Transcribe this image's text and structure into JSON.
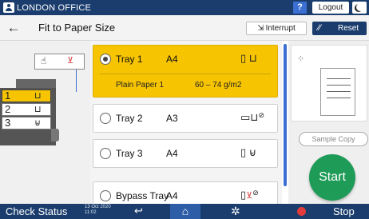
{
  "topbar": {
    "office_name": "LONDON OFFICE",
    "help_label": "?",
    "logout_label": "Logout"
  },
  "titlebar": {
    "back_symbol": "←",
    "title": "Fit to Paper Size",
    "interrupt_label": "Interrupt",
    "reset_label": "Reset"
  },
  "machine_diagram": {
    "trays": [
      {
        "number": "1",
        "selected": true
      },
      {
        "number": "2",
        "selected": false
      },
      {
        "number": "3",
        "selected": false
      }
    ]
  },
  "trays": [
    {
      "name": "Tray 1",
      "size": "A4",
      "selected": true,
      "paper_type": "Plain Paper 1",
      "paper_weight": "60 – 74 g/m2"
    },
    {
      "name": "Tray 2",
      "size": "A3",
      "selected": false
    },
    {
      "name": "Tray 3",
      "size": "A4",
      "selected": false
    },
    {
      "name": "Bypass Tray",
      "size": "A4",
      "selected": false
    }
  ],
  "right_panel": {
    "sample_copy_label": "Sample Copy",
    "start_label": "Start"
  },
  "bottombar": {
    "check_status_label": "Check Status",
    "date": "13 Oct 2020",
    "time": "11:02",
    "stop_label": "Stop"
  },
  "colors": {
    "header_bg": "#1a3d6d",
    "selected_tray": "#f6c400",
    "start_green": "#1f9b58",
    "accent_blue": "#3b6fd1",
    "stop_red": "#e23b3b"
  }
}
